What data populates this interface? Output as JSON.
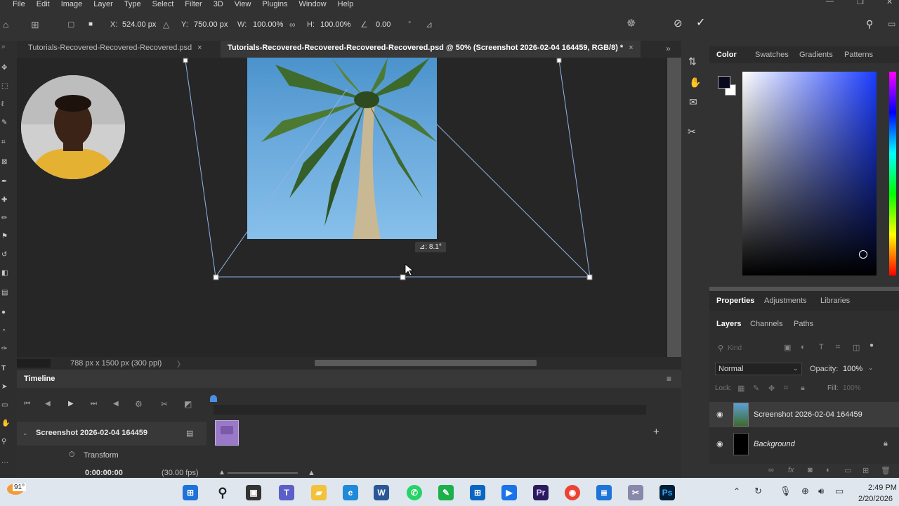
{
  "menu": [
    "File",
    "Edit",
    "Image",
    "Layer",
    "Type",
    "Select",
    "Filter",
    "3D",
    "View",
    "Plugins",
    "Window",
    "Help"
  ],
  "options": {
    "x_label": "X:",
    "x_value": "524.00 px",
    "y_label": "Y:",
    "y_value": "750.00 px",
    "w_label": "W:",
    "w_value": "100.00%",
    "h_label": "H:",
    "h_value": "100.00%",
    "angle_value": "0.00",
    "angle_unit": "°"
  },
  "tabs": [
    {
      "label": "Tutorials-Recovered-Recovered-Recovered.psd",
      "close": "×"
    },
    {
      "label": "Tutorials-Recovered-Recovered-Recovered-Recovered.psd @ 50% (Screenshot 2026-02-04 164459, RGB/8) *",
      "close": "×"
    }
  ],
  "canvas": {
    "angle_tooltip": "⊿: 8.1°",
    "status_info": "788 px x 1500 px (300 ppi)"
  },
  "timeline": {
    "title": "Timeline",
    "track_name": "Screenshot 2026-02-04 164459",
    "property": "Transform",
    "timecode": "0:00:00:00",
    "fps": "(30.00 fps)"
  },
  "color_panel": {
    "tabs": [
      "Color",
      "Swatches",
      "Gradients",
      "Patterns"
    ],
    "foreground": "#0a0a1e",
    "background": "#ffffff",
    "hue_color": "#1a3cff"
  },
  "properties_panel": {
    "tabs": [
      "Properties",
      "Adjustments",
      "Libraries"
    ],
    "layer_tabs": [
      "Layers",
      "Channels",
      "Paths"
    ],
    "kind_placeholder": "Kind",
    "blend_mode": "Normal",
    "opacity_label": "Opacity:",
    "opacity_value": "100%",
    "lock_label": "Lock:",
    "fill_label": "Fill:",
    "fill_value": "100%",
    "layers": [
      {
        "name": "Screenshot 2026-02-04 164459",
        "italic": false
      },
      {
        "name": "Background",
        "italic": true
      }
    ]
  },
  "taskbar": {
    "weather": "91°",
    "time": "2:49 PM",
    "date": "2/20/2026"
  }
}
